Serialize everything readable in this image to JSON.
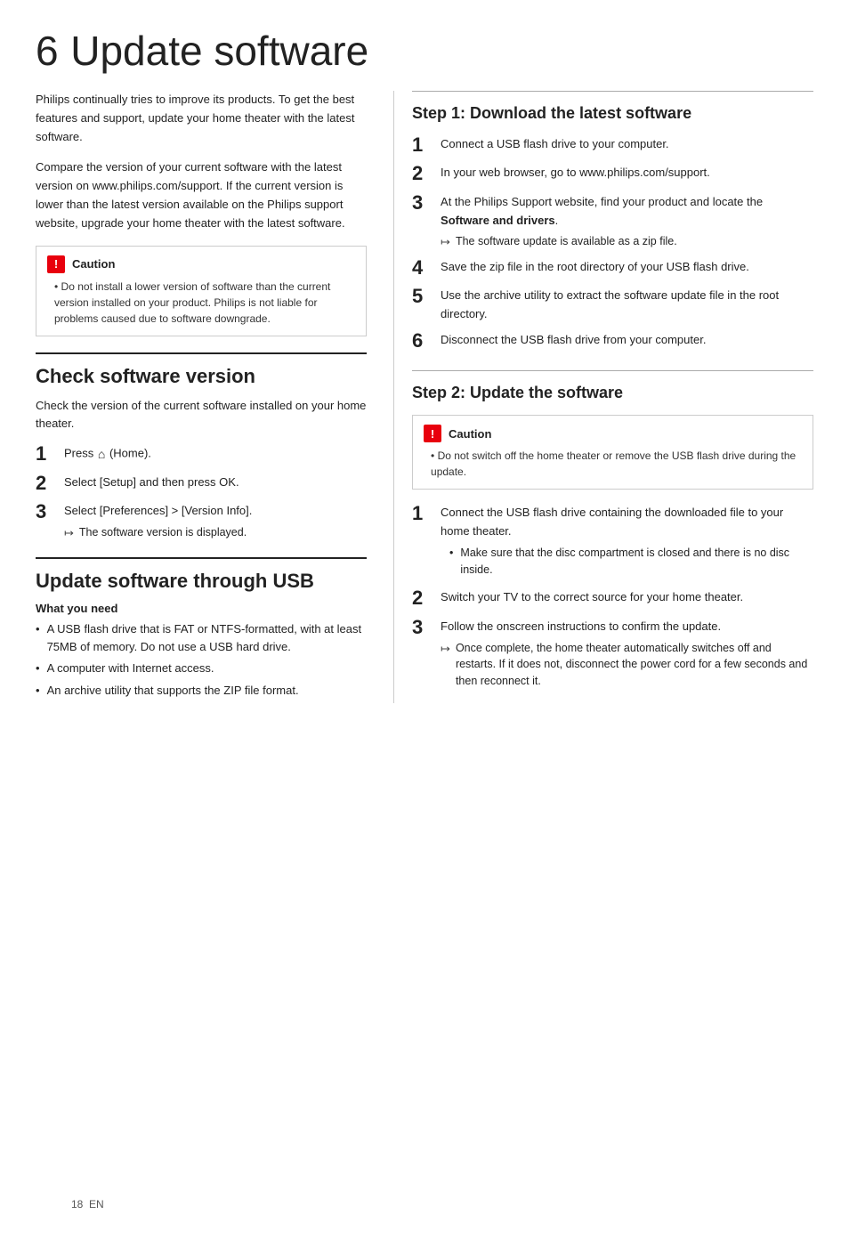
{
  "page": {
    "number": "18",
    "lang": "EN"
  },
  "chapter": {
    "number": "6",
    "title": "Update software"
  },
  "intro": {
    "paragraph1": "Philips continually tries to improve its products. To get the best features and support, update your home theater with the latest software.",
    "paragraph2": "Compare the version of your current software with the latest version on www.philips.com/support. If the current version is lower than the latest version available on the Philips support website, upgrade your home theater with the latest software."
  },
  "caution_left": {
    "header": "Caution",
    "items": [
      "Do not install a lower version of software than the current version installed on your product. Philips is not liable for problems caused due to software downgrade."
    ]
  },
  "check_software": {
    "title": "Check software version",
    "subtitle": "Check the version of the current software installed on your home theater.",
    "steps": [
      {
        "num": "1",
        "text": "Press ",
        "home": true,
        "home_label": "(Home)."
      },
      {
        "num": "2",
        "text": "Select [Setup] and then press OK."
      },
      {
        "num": "3",
        "text": "Select [Preferences] > [Version Info].",
        "arrow": "The software version is displayed."
      }
    ]
  },
  "update_usb": {
    "title": "Update software through USB",
    "what_you_need_label": "What you need",
    "items": [
      "A USB flash drive that is FAT or NTFS-formatted, with at least 75MB of memory. Do not use a USB hard drive.",
      "A computer with Internet access.",
      "An archive utility that supports the ZIP file format."
    ]
  },
  "step1": {
    "title": "Step 1: Download the latest software",
    "steps": [
      {
        "num": "1",
        "text": "Connect a USB flash drive to your computer."
      },
      {
        "num": "2",
        "text": "In your web browser, go to www.philips.com/support."
      },
      {
        "num": "3",
        "text": "At the Philips Support website, find your product and locate the ",
        "bold": "Software and drivers",
        "text_after": ".",
        "arrow": "The software update is available as a zip file."
      },
      {
        "num": "4",
        "text": "Save the zip file in the root directory of your USB flash drive."
      },
      {
        "num": "5",
        "text": "Use the archive utility to extract the software update file in the root directory."
      },
      {
        "num": "6",
        "text": "Disconnect the USB flash drive from your computer."
      }
    ]
  },
  "step2": {
    "title": "Step 2: Update the software",
    "caution": {
      "header": "Caution",
      "items": [
        "Do not switch off the home theater or remove the USB flash drive during the update."
      ]
    },
    "steps": [
      {
        "num": "1",
        "text": "Connect the USB flash drive containing the downloaded file to your home theater.",
        "bullets": [
          "Make sure that the disc compartment is closed and there is no disc inside."
        ]
      },
      {
        "num": "2",
        "text": "Switch your TV to the correct source for your home theater."
      },
      {
        "num": "3",
        "text": "Follow the onscreen instructions to confirm the update.",
        "arrow": "Once complete, the home theater automatically switches off and restarts. If it does not, disconnect the power cord for a few seconds and then reconnect it."
      }
    ]
  }
}
